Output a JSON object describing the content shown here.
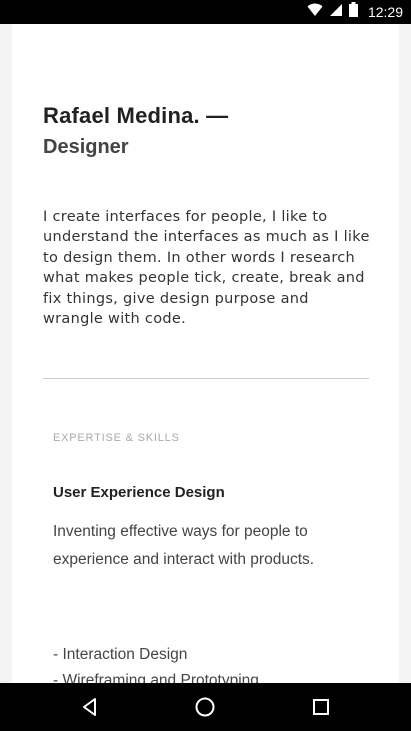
{
  "status_bar": {
    "time": "12:29",
    "icons": [
      "wifi-icon",
      "signal-icon",
      "battery-icon"
    ]
  },
  "profile": {
    "name": "Rafael Medina. —",
    "role": "Designer",
    "bio": "I create interfaces for people, I like to understand the interfaces as much as I like to design them. In other words I research what makes people tick, create, break and fix things, give design purpose and wrangle with code."
  },
  "expertise": {
    "section_label": "EXPERTISE & SKILLS",
    "skill_title": "User Experience Design",
    "skill_description": "Inventing effective ways for people to experience and interact with products.",
    "skill_items": [
      "- Interaction Design",
      "- Wireframing and Prototyping"
    ]
  },
  "nav_bar": {
    "buttons": [
      "back-icon",
      "home-icon",
      "recents-icon"
    ]
  }
}
